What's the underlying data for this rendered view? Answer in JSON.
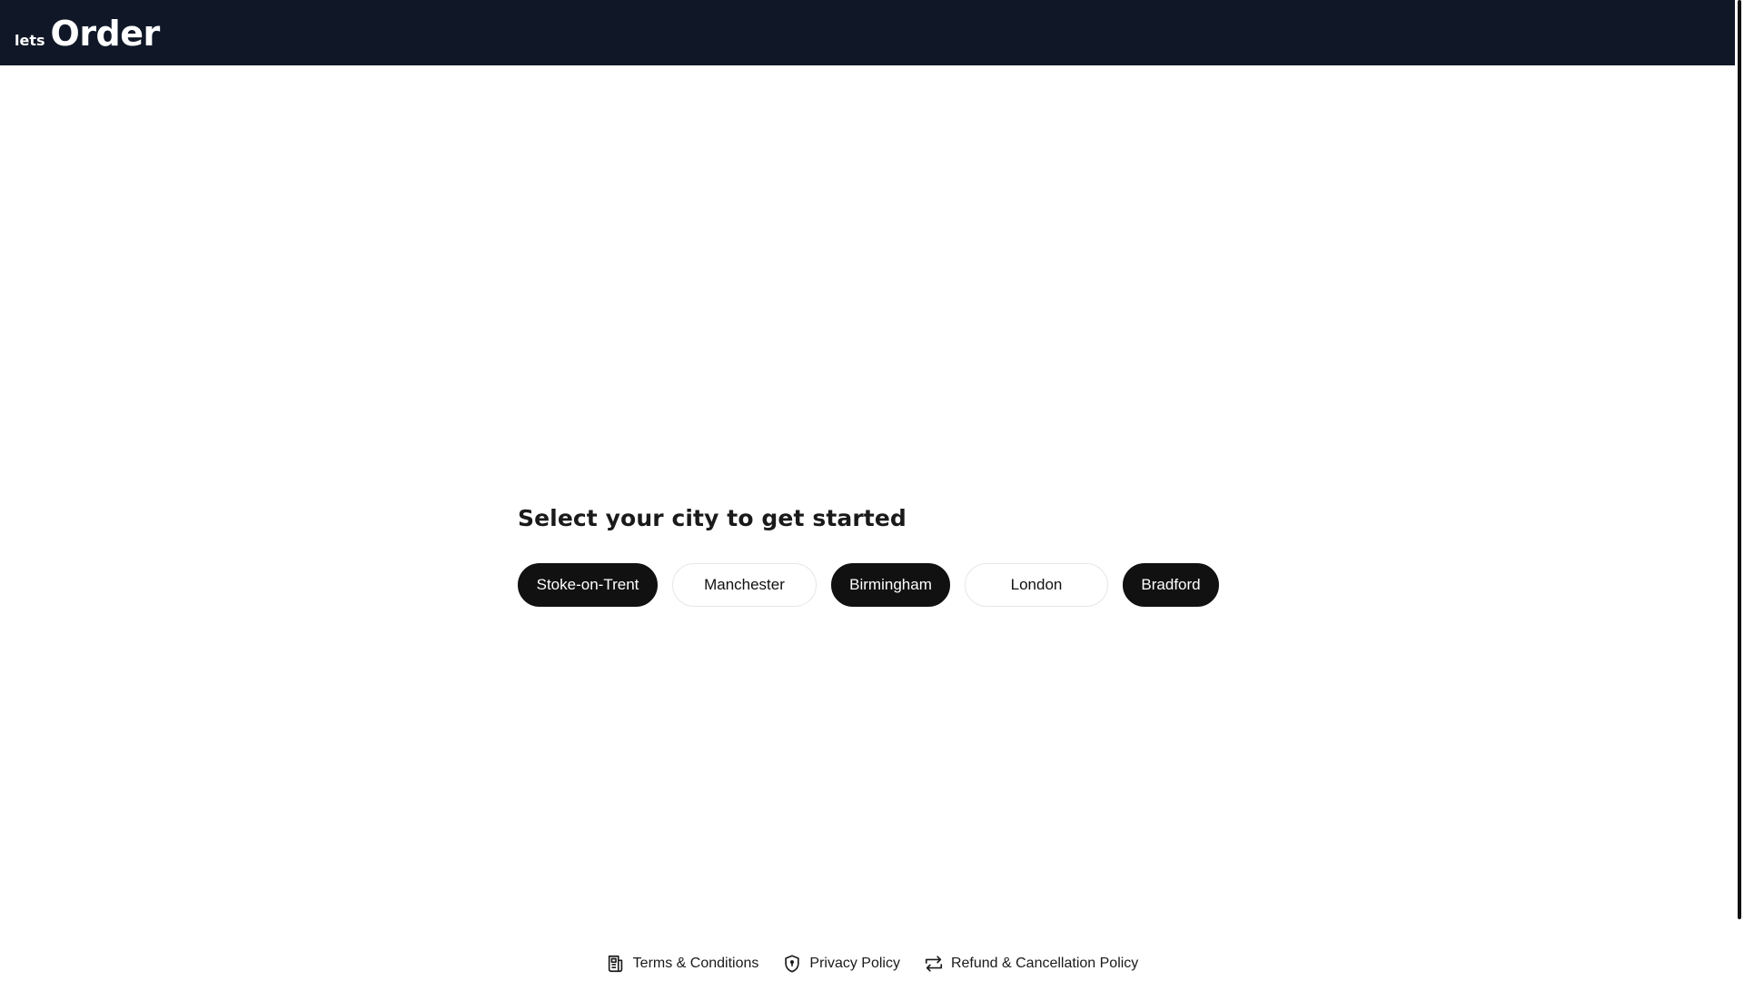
{
  "header": {
    "logo_small": "lets",
    "logo_big": "Order",
    "background_color": "#101828"
  },
  "city_selector": {
    "heading": "Select your city to get started",
    "cities": [
      {
        "label": "Stoke-on-Trent",
        "style": "dark"
      },
      {
        "label": "Manchester",
        "style": "light"
      },
      {
        "label": "Birmingham",
        "style": "dark"
      },
      {
        "label": "London",
        "style": "light"
      },
      {
        "label": "Bradford",
        "style": "dark"
      }
    ]
  },
  "footer": {
    "links": [
      {
        "label": "Terms & Conditions",
        "icon": "document-icon"
      },
      {
        "label": "Privacy Policy",
        "icon": "shield-icon"
      },
      {
        "label": "Refund & Cancellation Policy",
        "icon": "repeat-icon"
      }
    ]
  }
}
